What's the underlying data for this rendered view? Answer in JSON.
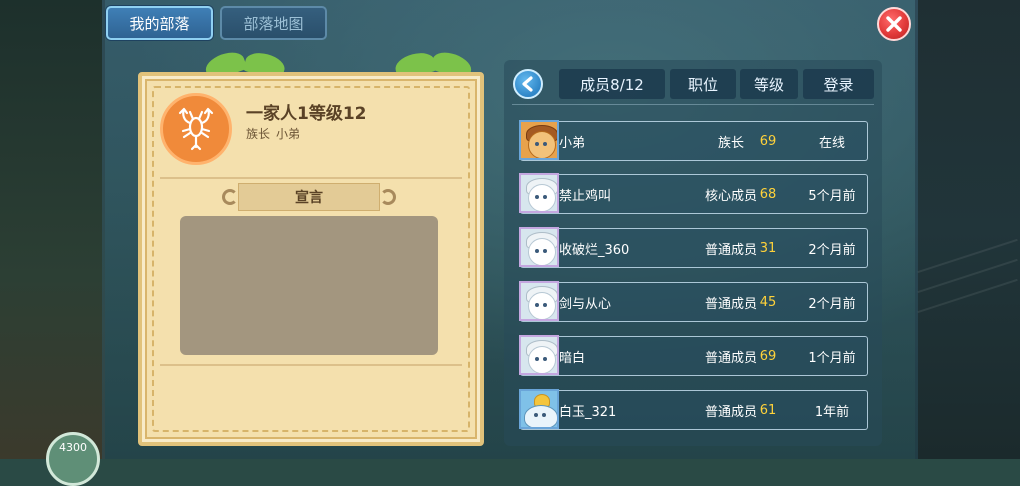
{
  "tabs": {
    "my_tribe": "我的部落",
    "tribe_map": "部落地图"
  },
  "tribe": {
    "name": "一家人1等级12",
    "leader_label": "族长",
    "leader_name": "小弟",
    "declaration_title": "宣言",
    "declaration_text": ""
  },
  "members_header": {
    "members_count": "成员8/12",
    "position": "职位",
    "level": "等级",
    "login": "登录"
  },
  "members": [
    {
      "name": "小弟",
      "role": "族长",
      "level": "69",
      "login": "在线",
      "avatar": "bear-avatar"
    },
    {
      "name": "禁止鸡叫",
      "role": "核心成员",
      "level": "68",
      "login": "5个月前",
      "avatar": "white-hair-avatar"
    },
    {
      "name": "收破烂_360",
      "role": "普通成员",
      "level": "31",
      "login": "2个月前",
      "avatar": "white-hair-avatar"
    },
    {
      "name": "剑与从心",
      "role": "普通成员",
      "level": "45",
      "login": "2个月前",
      "avatar": "white-hair-avatar"
    },
    {
      "name": "暗白",
      "role": "普通成员",
      "level": "69",
      "login": "1个月前",
      "avatar": "white-hair-avatar"
    },
    {
      "name": "白玉_321",
      "role": "普通成员",
      "level": "61",
      "login": "1年前",
      "avatar": "seal-avatar"
    }
  ],
  "currency": {
    "value": "4300"
  },
  "colors": {
    "level": "#ffd23a",
    "accent_tab": "#3f7fb6",
    "close": "#e23a3a",
    "emblem": "#f08a3a"
  }
}
